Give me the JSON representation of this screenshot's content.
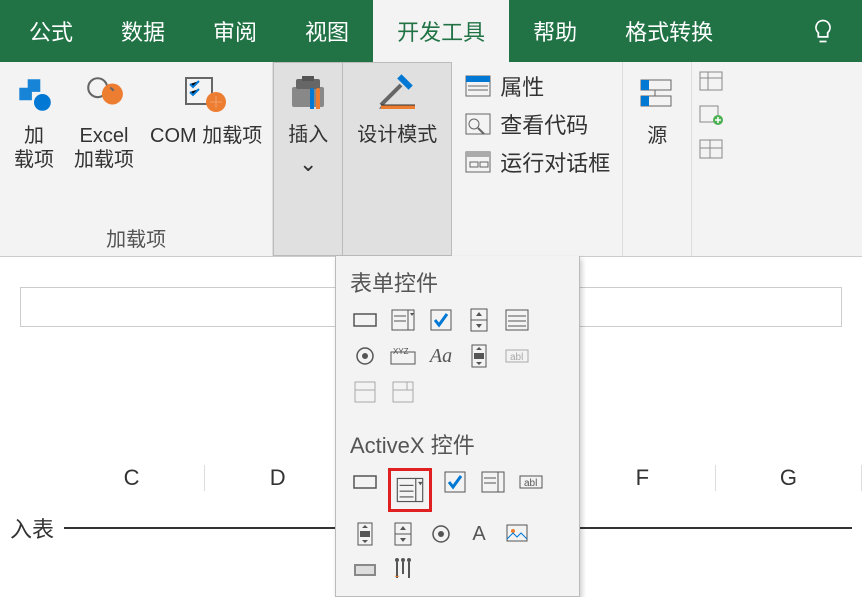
{
  "tabs": {
    "formulas": "公式",
    "data": "数据",
    "review": "审阅",
    "view": "视图",
    "developer": "开发工具",
    "help": "帮助",
    "format": "格式转换"
  },
  "addins_group": {
    "label": "加载项",
    "addins": "加\n载项",
    "excel_addins": "Excel\n加载项",
    "com_addins": "COM 加载项"
  },
  "controls_group": {
    "insert": "插入",
    "design_mode": "设计模式"
  },
  "props": {
    "properties": "属性",
    "view_code": "查看代码",
    "run_dialog": "运行对话框"
  },
  "source_group": {
    "source": "源"
  },
  "dropdown": {
    "form_controls": "表单控件",
    "activex_controls": "ActiveX 控件"
  },
  "columns": {
    "c": "C",
    "d": "D",
    "f": "F",
    "g": "G"
  },
  "row_label": "入表"
}
